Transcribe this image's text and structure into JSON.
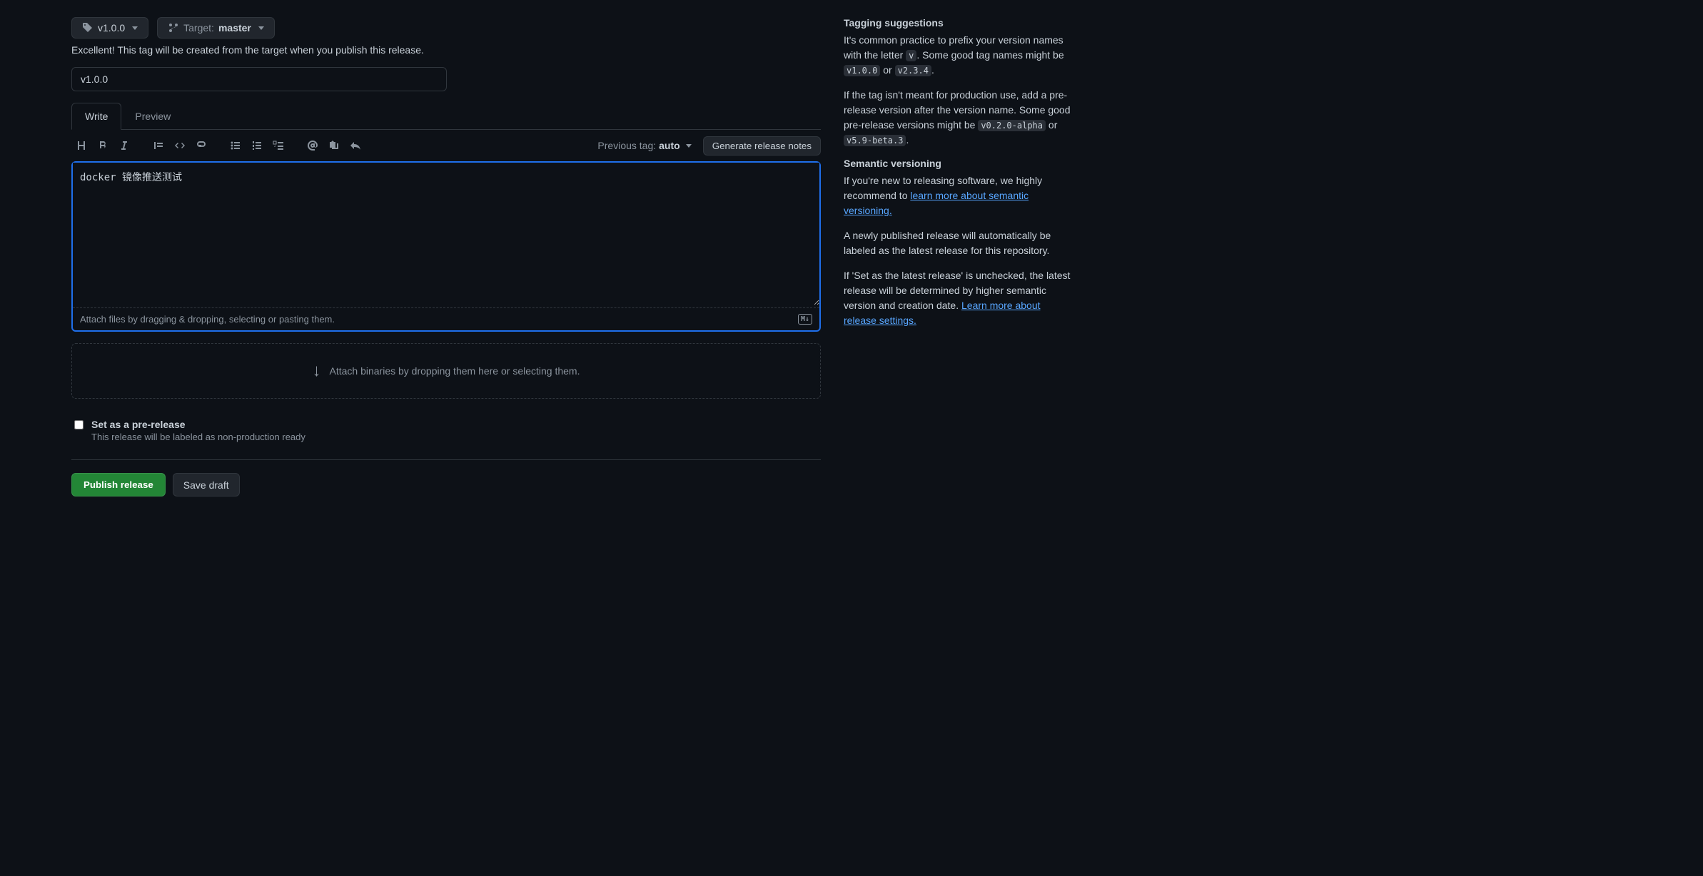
{
  "tag_selector": {
    "label": "v1.0.0"
  },
  "target": {
    "label": "Target:",
    "branch": "master"
  },
  "status": "Excellent! This tag will be created from the target when you publish this release.",
  "title_input_value": "v1.0.0",
  "tabs": {
    "write": "Write",
    "preview": "Preview"
  },
  "prev_tag": {
    "label": "Previous tag:",
    "value": "auto"
  },
  "generate_btn": "Generate release notes",
  "body_text": "docker 镜像推送测试",
  "attach_hint": "Attach files by dragging & dropping, selecting or pasting them.",
  "dropzone": "Attach binaries by dropping them here or selecting them.",
  "prerelease": {
    "label": "Set as a pre-release",
    "desc": "This release will be labeled as non-production ready"
  },
  "actions": {
    "publish": "Publish release",
    "save_draft": "Save draft"
  },
  "sidebar": {
    "tagging_h": "Tagging suggestions",
    "tagging_p1a": "It's common practice to prefix your version names with the letter ",
    "tagging_p1v": "v",
    "tagging_p1b": ". Some good tag names might be ",
    "tagging_ex1": "v1.0.0",
    "tagging_or": " or ",
    "tagging_ex2": "v2.3.4",
    "period": ".",
    "tagging_p2a": "If the tag isn't meant for production use, add a pre-release version after the version name. Some good pre-release versions might be ",
    "tagging_ex3": "v0.2.0-alpha",
    "tagging_ex4": "v5.9-beta.3",
    "semver_h": "Semantic versioning",
    "semver_p1a": "If you're new to releasing software, we highly recommend to ",
    "semver_link1": "learn more about semantic versioning.",
    "semver_p2": "A newly published release will automatically be labeled as the latest release for this repository.",
    "semver_p3a": "If 'Set as the latest release' is unchecked, the latest release will be determined by higher semantic version and creation date. ",
    "semver_link2": "Learn more about release settings."
  }
}
